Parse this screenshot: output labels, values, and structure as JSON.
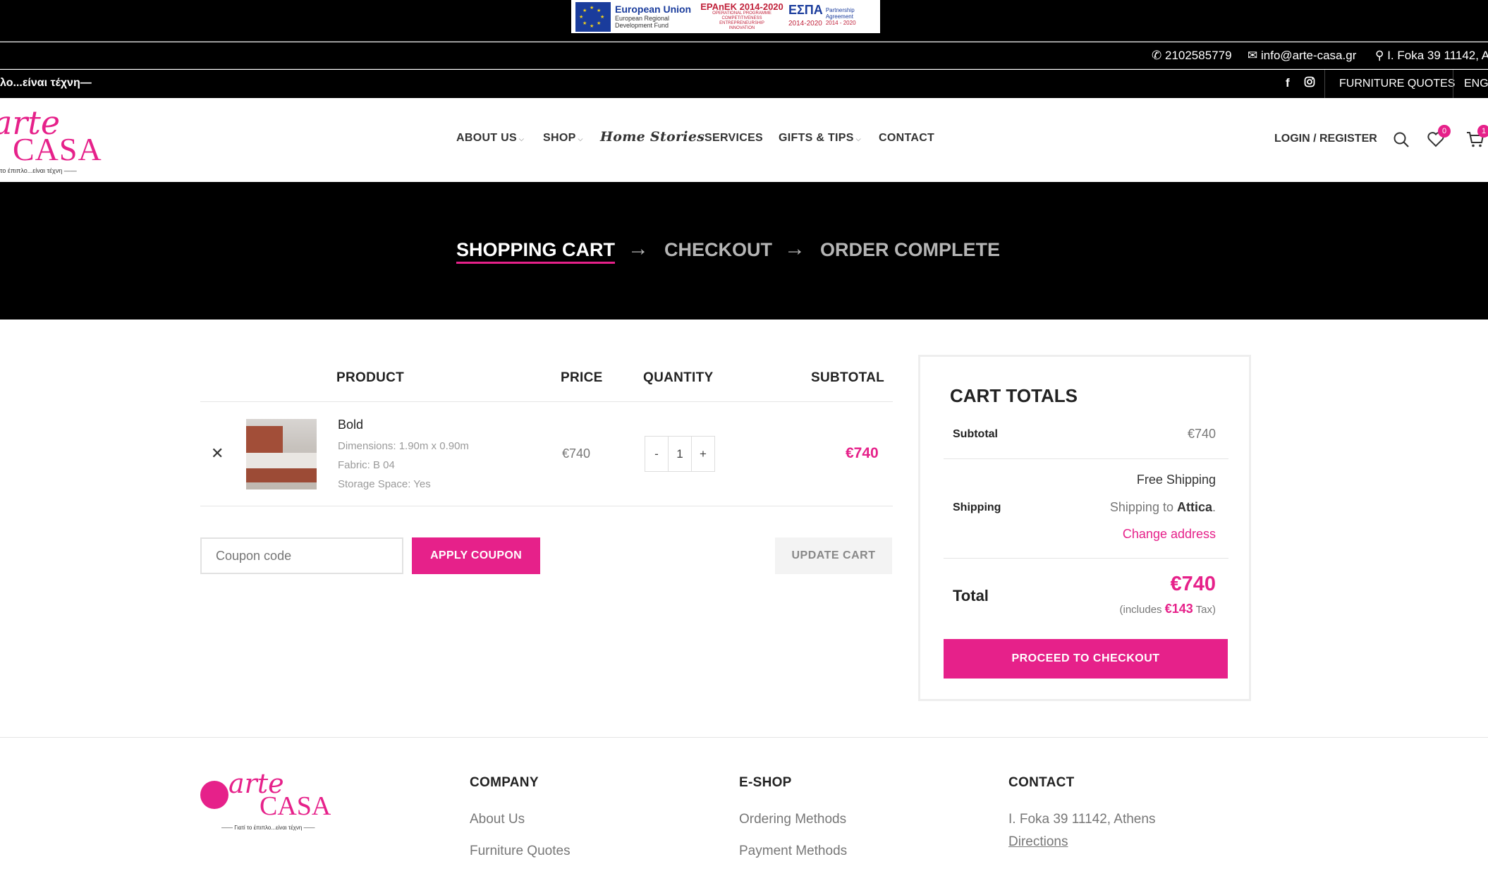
{
  "eu_banner": {
    "eu_title": "European Union",
    "eu_sub1": "European Regional",
    "eu_sub2": "Development Fund",
    "epanek_title": "EPAnEK 2014-2020",
    "epanek_sub1": "OPERATIONAL PROGRAMME",
    "epanek_sub2": "COMPETITIVENESS",
    "epanek_sub3": "ENTREPRENEURSHIP",
    "epanek_sub4": "INNOVATION",
    "espa_title": "ΕΣΠΑ",
    "espa_years": "2014-2020",
    "espa_sub1": "Partnership",
    "espa_sub2": "Agreement",
    "espa_sub3": "2014 - 2020"
  },
  "contact_bar": {
    "phone": "2102585779",
    "email": "info@arte-casa.gr",
    "address": "I. Foka 39 11142, A"
  },
  "tag_bar": {
    "tagline": "λο...είναι τέχνη—",
    "furniture_quotes": "FURNITURE QUOTES",
    "language": "ENGL"
  },
  "header": {
    "logo_arte": "arte",
    "logo_casa": "CASA",
    "logo_slogan": "το έπιπλο...είναι τέχνη ——",
    "nav": {
      "about": "ABOUT US",
      "shop": "SHOP",
      "home_stories": "Home Stories",
      "services": "SERVICES",
      "gifts": "GIFTS & TIPS",
      "contact": "CONTACT"
    },
    "login": "LOGIN / REGISTER",
    "wishlist_count": "0",
    "cart_count": "1"
  },
  "steps": {
    "cart": "SHOPPING CART",
    "checkout": "CHECKOUT",
    "complete": "ORDER COMPLETE"
  },
  "cart": {
    "headers": {
      "product": "PRODUCT",
      "price": "PRICE",
      "quantity": "QUANTITY",
      "subtotal": "SUBTOTAL"
    },
    "item": {
      "name": "Bold",
      "dimensions": "Dimensions: 1.90m x 0.90m",
      "fabric": "Fabric: B 04",
      "storage": "Storage Space: Yes",
      "price": "€740",
      "quantity": "1",
      "subtotal": "€740"
    },
    "coupon_placeholder": "Coupon code",
    "apply_coupon": "APPLY COUPON",
    "update_cart": "UPDATE CART"
  },
  "totals": {
    "title": "CART TOTALS",
    "subtotal_label": "Subtotal",
    "subtotal_value": "€740",
    "shipping_label": "Shipping",
    "shipping_method": "Free Shipping",
    "shipping_to_prefix": "Shipping to ",
    "shipping_region": "Attica",
    "shipping_to_suffix": ".",
    "change_address": "Change address",
    "total_label": "Total",
    "total_value": "€740",
    "tax_prefix": "(includes ",
    "tax_value": "€143",
    "tax_suffix": " Tax)",
    "proceed": "PROCEED TO CHECKOUT"
  },
  "footer": {
    "logo_arte": "arte",
    "logo_casa": "CASA",
    "logo_slogan": "—— Γιατί το έπιπλο...είναι τέχνη ——",
    "company_title": "COMPANY",
    "company_links": [
      "About Us",
      "Furniture Quotes"
    ],
    "eshop_title": "E-SHOP",
    "eshop_links": [
      "Ordering Methods",
      "Payment Methods"
    ],
    "contact_title": "CONTACT",
    "contact_address": "I. Foka 39 11142, Athens",
    "contact_directions": "Directions"
  },
  "colors": {
    "accent": "#e6218a",
    "dark": "#000000",
    "muted": "#777777"
  }
}
